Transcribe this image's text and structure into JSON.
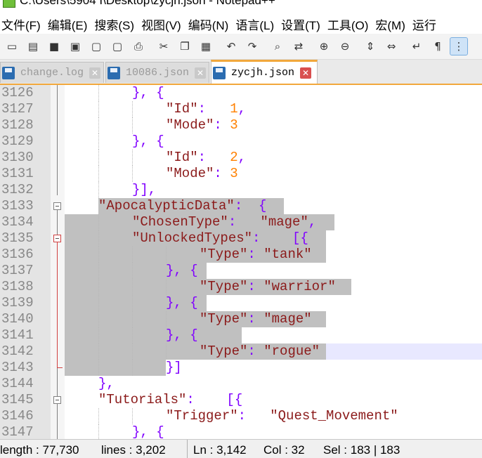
{
  "window": {
    "title": "C:\\Users\\5904 I\\Desktop\\zycjh.json - Notepad++",
    "accent_color": "#f2a83c"
  },
  "menu": [
    {
      "label": "文件(F)"
    },
    {
      "label": "编辑(E)"
    },
    {
      "label": "搜索(S)"
    },
    {
      "label": "视图(V)"
    },
    {
      "label": "编码(N)"
    },
    {
      "label": "语言(L)"
    },
    {
      "label": "设置(T)"
    },
    {
      "label": "工具(O)"
    },
    {
      "label": "宏(M)"
    },
    {
      "label": "运行"
    }
  ],
  "toolbar": [
    {
      "icon": "new-file-icon",
      "glyph": "▭"
    },
    {
      "icon": "open-file-icon",
      "glyph": "▤"
    },
    {
      "icon": "save-icon",
      "glyph": "■"
    },
    {
      "icon": "save-all-icon",
      "glyph": "▣"
    },
    {
      "icon": "close-icon",
      "glyph": "▢"
    },
    {
      "icon": "close-all-icon",
      "glyph": "▢"
    },
    {
      "icon": "print-icon",
      "glyph": "⎙"
    },
    {
      "icon": "cut-icon",
      "glyph": "✂"
    },
    {
      "icon": "copy-icon",
      "glyph": "❐"
    },
    {
      "icon": "paste-icon",
      "glyph": "▦"
    },
    {
      "icon": "undo-icon",
      "glyph": "↶"
    },
    {
      "icon": "redo-icon",
      "glyph": "↷"
    },
    {
      "icon": "find-icon",
      "glyph": "⌕"
    },
    {
      "icon": "replace-icon",
      "glyph": "⇄"
    },
    {
      "icon": "zoom-in-icon",
      "glyph": "⊕"
    },
    {
      "icon": "zoom-out-icon",
      "glyph": "⊖"
    },
    {
      "icon": "sync-vertical-icon",
      "glyph": "⇕"
    },
    {
      "icon": "sync-horizontal-icon",
      "glyph": "⇔"
    },
    {
      "icon": "word-wrap-icon",
      "glyph": "↵"
    },
    {
      "icon": "show-all-chars-icon",
      "glyph": "¶"
    },
    {
      "icon": "indent-guide-icon",
      "glyph": "⋮"
    }
  ],
  "tabs": [
    {
      "label": "change.log",
      "active": false
    },
    {
      "label": "10086.json",
      "active": false
    },
    {
      "label": "zycjh.json",
      "active": true
    }
  ],
  "editor": {
    "lines": [
      {
        "num": "3126",
        "segs": [
          [
            "p",
            "}, {"
          ]
        ]
      },
      {
        "num": "3127",
        "segs": [
          [
            "k",
            "\"Id\""
          ],
          [
            "p",
            ":   "
          ],
          [
            "n",
            "1"
          ],
          [
            "p",
            ","
          ]
        ]
      },
      {
        "num": "3128",
        "segs": [
          [
            "k",
            "\"Mode\""
          ],
          [
            "p",
            ": "
          ],
          [
            "n",
            "3"
          ]
        ]
      },
      {
        "num": "3129",
        "segs": [
          [
            "p",
            "}, {"
          ]
        ]
      },
      {
        "num": "3130",
        "segs": [
          [
            "k",
            "\"Id\""
          ],
          [
            "p",
            ":   "
          ],
          [
            "n",
            "2"
          ],
          [
            "p",
            ","
          ]
        ]
      },
      {
        "num": "3131",
        "segs": [
          [
            "k",
            "\"Mode\""
          ],
          [
            "p",
            ": "
          ],
          [
            "n",
            "3"
          ]
        ]
      },
      {
        "num": "3132",
        "segs": [
          [
            "p",
            "}],"
          ]
        ]
      },
      {
        "num": "3133",
        "segs": [
          [
            "k",
            "\"ApocalypticData\""
          ],
          [
            "p",
            ":  {"
          ]
        ]
      },
      {
        "num": "3134",
        "segs": [
          [
            "k",
            "\"ChosenType\""
          ],
          [
            "p",
            ":   "
          ],
          [
            "k",
            "\"mage\""
          ],
          [
            "p",
            ","
          ]
        ]
      },
      {
        "num": "3135",
        "segs": [
          [
            "k",
            "\"UnlockedTypes\""
          ],
          [
            "p",
            ":    [{"
          ]
        ]
      },
      {
        "num": "3136",
        "segs": [
          [
            "k",
            "\"Type\""
          ],
          [
            "p",
            ": "
          ],
          [
            "k",
            "\"tank\""
          ]
        ]
      },
      {
        "num": "3137",
        "segs": [
          [
            "p",
            "}, {"
          ]
        ]
      },
      {
        "num": "3138",
        "segs": [
          [
            "k",
            "\"Type\""
          ],
          [
            "p",
            ": "
          ],
          [
            "k",
            "\"warrior\""
          ]
        ]
      },
      {
        "num": "3139",
        "segs": [
          [
            "p",
            "}, {"
          ]
        ]
      },
      {
        "num": "3140",
        "segs": [
          [
            "k",
            "\"Type\""
          ],
          [
            "p",
            ": "
          ],
          [
            "k",
            "\"mage\""
          ]
        ]
      },
      {
        "num": "3141",
        "segs": [
          [
            "p",
            "}, {"
          ]
        ]
      },
      {
        "num": "3142",
        "segs": [
          [
            "k",
            "\"Type\""
          ],
          [
            "p",
            ": "
          ],
          [
            "k",
            "\"rogue\""
          ]
        ]
      },
      {
        "num": "3143",
        "segs": [
          [
            "p",
            "}]"
          ]
        ]
      },
      {
        "num": "3144",
        "segs": [
          [
            "p",
            "},"
          ]
        ]
      },
      {
        "num": "3145",
        "segs": [
          [
            "k",
            "\"Tutorials\""
          ],
          [
            "p",
            ":    [{"
          ]
        ]
      },
      {
        "num": "3146",
        "segs": [
          [
            "k",
            "\"Trigger\""
          ],
          [
            "p",
            ":   "
          ],
          [
            "k",
            "\"Quest_Movement\""
          ]
        ]
      },
      {
        "num": "3147",
        "segs": [
          [
            "p",
            "}, {"
          ]
        ]
      }
    ]
  },
  "status": {
    "length": "length : 77,730",
    "lines": "lines : 3,202",
    "ln": "Ln : 3,142",
    "col": "Col : 32",
    "sel": "Sel : 183 | 183"
  }
}
